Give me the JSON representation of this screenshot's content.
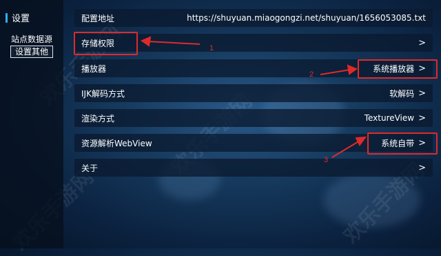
{
  "sidebar": {
    "title": "设置",
    "items": [
      {
        "label": "站点数据源"
      },
      {
        "label": "设置其他"
      }
    ]
  },
  "rows": [
    {
      "label": "配置地址",
      "value": "https://shuyuan.miaogongzi.net/shuyuan/1656053085.txt",
      "chevron": ">"
    },
    {
      "label": "存储权限",
      "value": "",
      "chevron": ">"
    },
    {
      "label": "播放器",
      "value": "系统播放器",
      "chevron": ">"
    },
    {
      "label": "IJK解码方式",
      "value": "软解码",
      "chevron": ">"
    },
    {
      "label": "渲染方式",
      "value": "TextureView",
      "chevron": ">"
    },
    {
      "label": "资源解析WebView",
      "value": "系统自带",
      "chevron": ">"
    },
    {
      "label": "关于",
      "value": "",
      "chevron": ">"
    }
  ],
  "annotations": {
    "n1": "1",
    "n2": "2",
    "n3": "3",
    "color": "#e02a2a"
  },
  "watermark": "欢乐手游网",
  "colors": {
    "accent": "#2fb0ff",
    "highlight": "#e02a2a"
  }
}
